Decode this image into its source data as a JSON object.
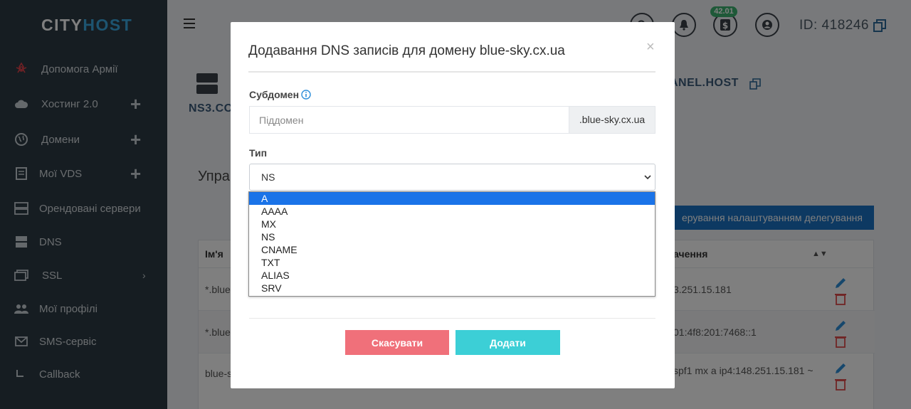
{
  "sidebar": {
    "logo_part1": "CITY",
    "logo_part2": "HOST",
    "items": [
      {
        "label": "Допомога Армії",
        "icon": "ribbon-icon"
      },
      {
        "label": "Хостинг 2.0",
        "icon": "cloud-icon",
        "plus": "+"
      },
      {
        "label": "Домени",
        "icon": "globe-icon",
        "plus": "+"
      },
      {
        "label": "Мої VDS",
        "icon": "vds-icon",
        "plus": "+"
      },
      {
        "label": "Орендовані сервери",
        "icon": "server-icon"
      },
      {
        "label": "DNS",
        "icon": "dns-icon"
      },
      {
        "label": "SSL",
        "icon": "ssl-icon",
        "chevron": "›"
      },
      {
        "label": "Мої профілі",
        "icon": "users-icon"
      },
      {
        "label": "SMS-сервіс",
        "icon": "mail-icon"
      },
      {
        "label": "Callback",
        "icon": "callback-icon"
      }
    ]
  },
  "header": {
    "balance_badge": "42.01",
    "user_id": "ID: 418246"
  },
  "background": {
    "ns3_text": "NS3.CO",
    "ns_right": "ANEL.HOST",
    "manage_heading": "Упра",
    "delegation_button": "ерування налаштуванням делегування",
    "table": {
      "col_name": "Ім'я",
      "col_value": "ачення",
      "rows": [
        {
          "name": "*.blue",
          "value": "3.251.15.181"
        },
        {
          "name": "*.blue",
          "value": "01:4f8:201:7468::1"
        },
        {
          "name": "blue-s",
          "value": "spf1 mx a ip4:148.251.15.181 ~"
        }
      ]
    }
  },
  "modal": {
    "title": "Додавання DNS записів для домену blue-sky.cx.ua",
    "close": "×",
    "subdomain_label": "Субдомен",
    "subdomain_placeholder": "Піддомен",
    "subdomain_value": "",
    "domain_suffix": ".blue-sky.cx.ua",
    "type_label": "Тип",
    "type_selected": "NS",
    "type_options": [
      "A",
      "AAAA",
      "MX",
      "NS",
      "CNAME",
      "TXT",
      "ALIAS",
      "SRV"
    ],
    "highlighted_option": "A",
    "cancel_label": "Скасувати",
    "add_label": "Додати"
  },
  "colors": {
    "sidebar_bg": "#2d3a44",
    "accent_blue": "#1a73c4",
    "cancel_red": "#f0707a",
    "add_cyan": "#3ccfd6",
    "badge_green": "#3cb371"
  }
}
